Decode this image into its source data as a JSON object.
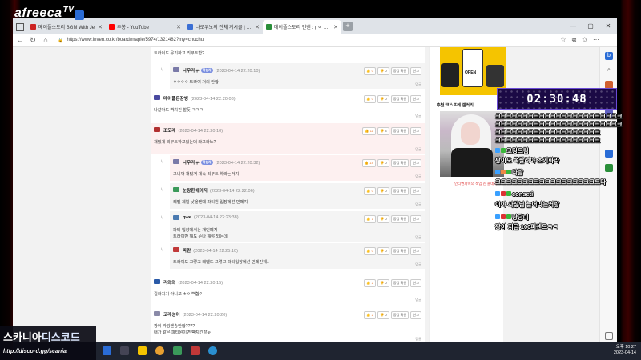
{
  "brand": {
    "logo": "afreeca",
    "logo_tv": "TV"
  },
  "browser": {
    "tabs": [
      {
        "label": "메이플스토리 BGM With Je",
        "fav_color": "#cc2222",
        "active": false
      },
      {
        "label": "추봉 - YouTube",
        "fav_color": "#ff0000",
        "active": false
      },
      {
        "label": "나로우노의 전체 게시글 | 아프리",
        "fav_color": "#3b6fd4",
        "active": false
      },
      {
        "label": "메이플스토리 인벤 : ( ㅇ ω ) 나로우",
        "fav_color": "#2a8f3a",
        "active": true
      }
    ],
    "new_tab": "+",
    "window_controls": [
      "—",
      "▢",
      "✕"
    ],
    "url": "https://www.inven.co.kr/board/maple/5974/1321482?my=chuchu"
  },
  "page": {
    "top_text": "트라이도 유기하고 리부트함?",
    "top_dap": "답글",
    "comments": [
      {
        "name": "나우라누",
        "tag": "작성자",
        "date": "(2023-04-14 22:20:10)",
        "body": [
          "ㅇㅇㅇㅇ 트라이 거의 안함"
        ],
        "up": "0",
        "down": "0",
        "reply": true,
        "shade": "shaded",
        "avatar": "#7a7aa8"
      },
      {
        "name": "메이플은잠뱅",
        "tag": "",
        "date": "(2023-04-14 22:20:03)",
        "body": [
          "나같아도 빡치긴 할듯 ㅋㅋㅋ"
        ],
        "up": "0",
        "down": "0",
        "reply": false,
        "shade": "",
        "avatar": "#4a4aa0"
      },
      {
        "name": "조모레",
        "tag": "",
        "date": "(2023-04-14 22:20:10)",
        "body": [
          "재밌게 리부트하고있는데 와그라노?"
        ],
        "up": "11",
        "down": "4",
        "reply": false,
        "shade": "pink",
        "avatar": "#b23030"
      },
      {
        "name": "나우라누",
        "tag": "작성자",
        "date": "(2023-04-14 22:20:32)",
        "body": [
          "그니까 재밌게 계속 리부트 하라는거지"
        ],
        "up": "18",
        "down": "0",
        "reply": true,
        "shade": "pink",
        "avatar": "#7a7aa8"
      },
      {
        "name": "눈탕한에이지",
        "tag": "",
        "date": "(2023-04-14 22:22:06)",
        "body": [
          "레벨 제일 낮을텐데 파티원 입장에선 민폐지"
        ],
        "up": "0",
        "down": "0",
        "reply": true,
        "shade": "shaded",
        "avatar": "#3a9a5a"
      },
      {
        "name": "qwe",
        "tag": "",
        "date": "(2023-04-14 22:23:38)",
        "body": [
          "파티 입장에서는 개민폐지",
          "트라이만 해도 존나 해야 되는데"
        ],
        "up": "1",
        "down": "0",
        "reply": true,
        "shade": "shaded",
        "avatar": "#4a7ab0"
      },
      {
        "name": "파란",
        "tag": "",
        "date": "(2023-04-14 22:25:10)",
        "body": [
          "트라이도 그렇고 레벨도 그렇고 파티입장에선 민폐긴해.."
        ],
        "up": "0",
        "down": "0",
        "reply": true,
        "shade": "shaded",
        "avatar": "#c03838"
      },
      {
        "name": "리와와",
        "tag": "",
        "date": "(2023-04-14 22:20:15)",
        "body": [
          "길라치기 아니고 ㅎㅇ 뻑함?"
        ],
        "up": "2",
        "down": "0",
        "reply": false,
        "shade": "",
        "avatar": "#2a5aa8"
      },
      {
        "name": "고래성어",
        "tag": "",
        "date": "(2023-04-14 22:20:20)",
        "body": [
          "팡이 카링엔송안함????",
          "내가 같은 파티원이면 빡치긴할듯"
        ],
        "up": "2",
        "down": "0",
        "reply": false,
        "shade": "",
        "avatar": "#8a8aa8"
      }
    ],
    "btn_report_gong": "공감 확인",
    "btn_report": "신고",
    "dap": "답글",
    "cos_header": "추천 코스프레 갤러리",
    "cos_caption": "인티엔파이의 책임 진 볼네이",
    "ad_text": "OPEN"
  },
  "timer": "02:30:48",
  "chat": [
    "크크크크크크크크크크크크크크크크크크크크크크크",
    "크크크크크크크크크크크크크크크크크크크크크크크",
    "크크크크크크크크크크크크크크크크크크크",
    "크크크크크크크크크크크크크크크크크크크",
    "코딩드림",
    "팡이도 쪽팔려야 초기화라",
    "다람",
    "크크크크크크크크크크크크크크크크크크트다",
    "conseti",
    "이야 사장님 늘어나는거랑",
    "냥당이",
    "팡이 지금 100퍼센드ㅋㅋ"
  ],
  "banner": {
    "line1_a": "스카니아",
    "line1_b": "디스코드",
    "line2": "http://discord.gg/scania"
  },
  "clock": {
    "time": "오후 10:27",
    "date": "2023-04-14"
  }
}
